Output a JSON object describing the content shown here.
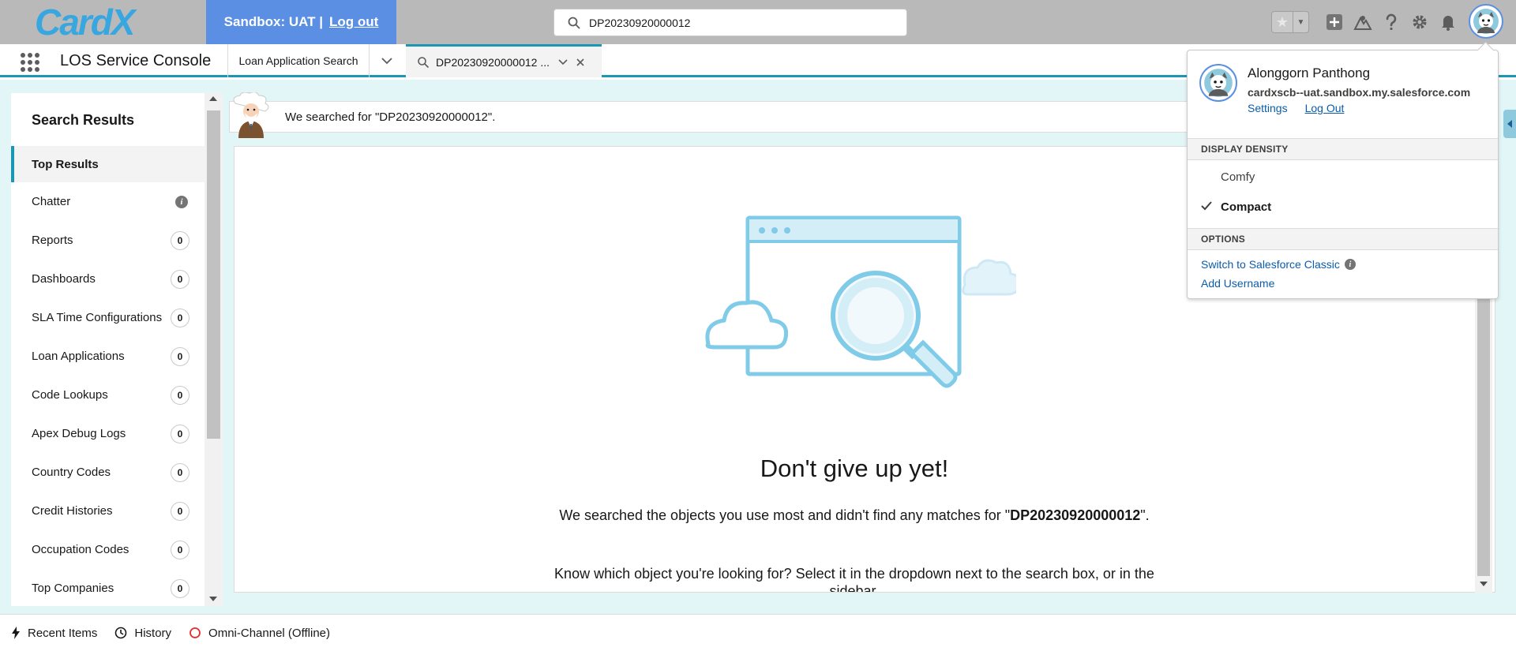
{
  "header": {
    "logo_text": "CardX",
    "sandbox_label": "Sandbox: UAT |",
    "sandbox_logout": "Log out",
    "search_value": "DP20230920000012",
    "icons": [
      "favorites-star-icon",
      "favorites-list-icon",
      "add-icon",
      "trailhead-icon",
      "help-icon",
      "setup-gear-icon",
      "notifications-bell-icon",
      "user-avatar-icon"
    ]
  },
  "nav": {
    "app_name": "LOS Service Console",
    "tabs": [
      {
        "label": "Loan Application Search"
      },
      {
        "label": "DP20230920000012 ...",
        "active": true
      }
    ]
  },
  "sidebar": {
    "title": "Search Results",
    "items": [
      {
        "label": "Top Results",
        "active": true
      },
      {
        "label": "Chatter",
        "info": "i"
      },
      {
        "label": "Reports",
        "count": "0"
      },
      {
        "label": "Dashboards",
        "count": "0"
      },
      {
        "label": "SLA Time Configurations",
        "count": "0"
      },
      {
        "label": "Loan Applications",
        "count": "0"
      },
      {
        "label": "Code Lookups",
        "count": "0"
      },
      {
        "label": "Apex Debug Logs",
        "count": "0"
      },
      {
        "label": "Country Codes",
        "count": "0"
      },
      {
        "label": "Credit Histories",
        "count": "0"
      },
      {
        "label": "Occupation Codes",
        "count": "0"
      },
      {
        "label": "Top Companies",
        "count": "0"
      }
    ]
  },
  "main": {
    "search_message": "We searched for \"DP20230920000012\".",
    "empty_title": "Don't give up yet!",
    "empty_text_prefix": "We searched the objects you use most and didn't find any matches for \"",
    "empty_text_term": "DP20230920000012",
    "empty_text_suffix": "\".",
    "empty_hint": "Know which object you're looking for? Select it in the dropdown next to the search box, or in the sidebar."
  },
  "profile": {
    "name": "Alonggorn Panthong",
    "domain": "cardxscb--uat.sandbox.my.salesforce.com",
    "settings_label": "Settings",
    "logout_label": "Log Out",
    "density_header": "DISPLAY DENSITY",
    "density_options": [
      {
        "label": "Comfy",
        "selected": false
      },
      {
        "label": "Compact",
        "selected": true
      }
    ],
    "options_header": "OPTIONS",
    "switch_classic": "Switch to Salesforce Classic",
    "add_username": "Add Username"
  },
  "utility_bar": {
    "items": [
      {
        "label": "Recent Items",
        "icon": "lightning-bolt-icon"
      },
      {
        "label": "History",
        "icon": "clock-icon"
      },
      {
        "label": "Omni-Channel (Offline)",
        "icon": "omni-status-offline-icon"
      }
    ]
  },
  "colors": {
    "header_bg": "#b9b9b9",
    "sandbox_banner": "#5b8fe3",
    "accent": "#1b96b5",
    "workspace_bg": "#e3f6f7",
    "link": "#0b5cab",
    "illustration": "#7fcbe8",
    "offline_status": "#e42d2d"
  }
}
